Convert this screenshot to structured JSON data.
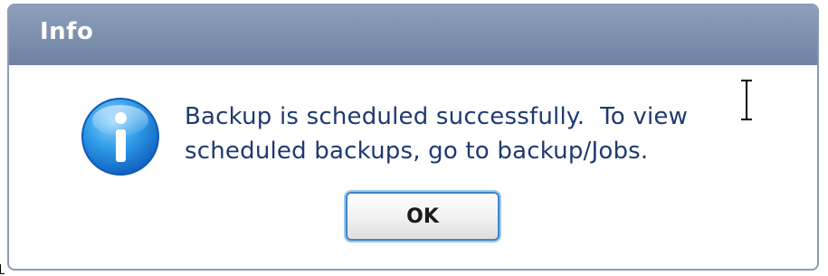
{
  "dialog": {
    "title": "Info",
    "icon": "info-icon",
    "message_lines": [
      "Backup is scheduled successfully.  To view",
      "scheduled backups, go to backup/Jobs."
    ],
    "ok_label": "OK"
  },
  "colors": {
    "titlebar": "#7c8fad",
    "message_text": "#1f3a70",
    "button_border": "#3b86c8"
  }
}
